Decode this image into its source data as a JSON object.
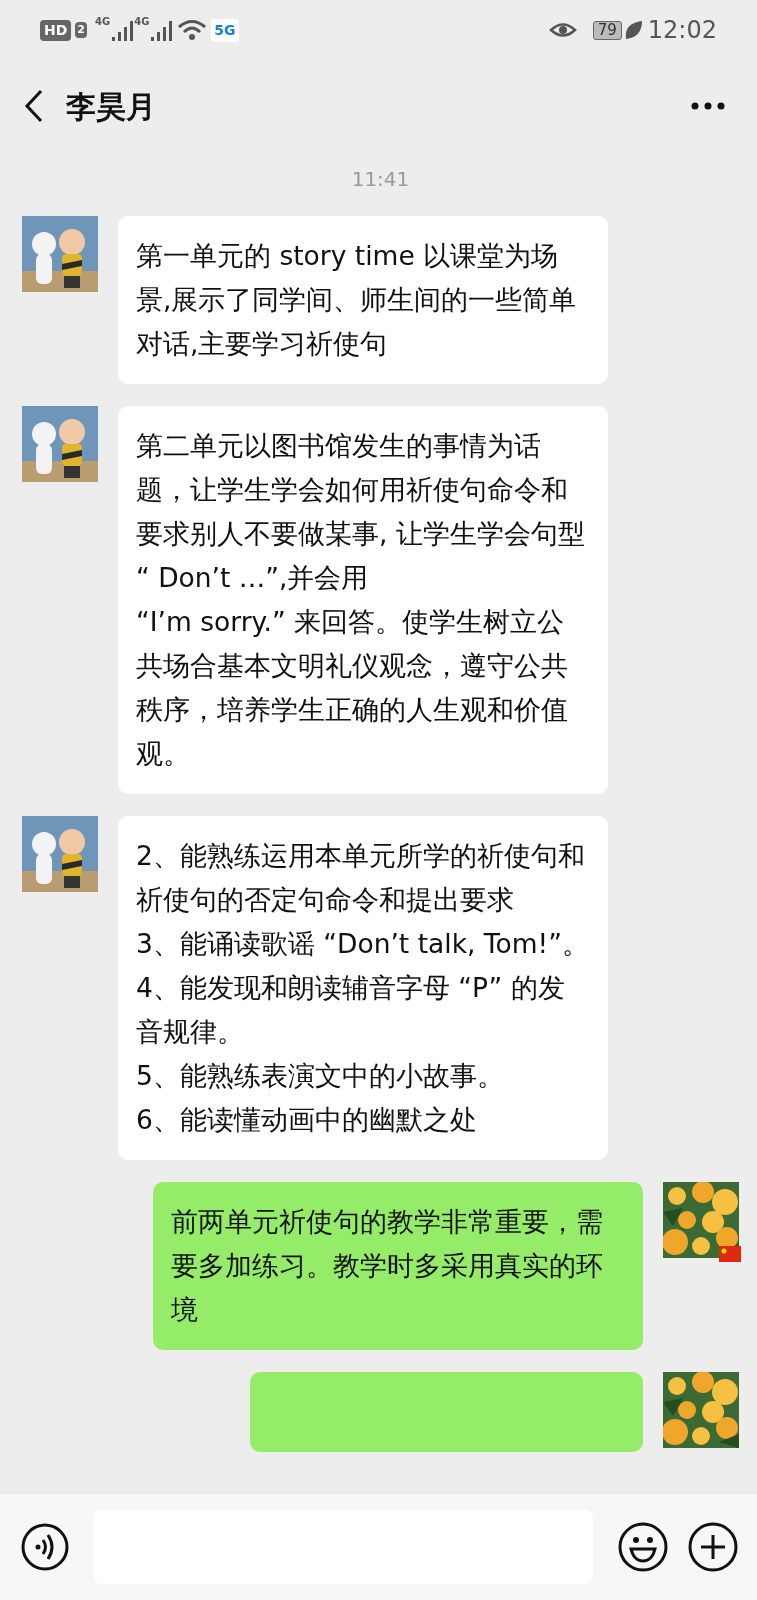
{
  "status_bar": {
    "hd": "HD",
    "sim": "2",
    "network_1": "4G",
    "network_2": "4G",
    "badge_5g": "5G",
    "battery": "79",
    "time": "12:02"
  },
  "header": {
    "title": "李昊月"
  },
  "messages": [
    {
      "kind": "time",
      "text": "11:41"
    },
    {
      "kind": "message",
      "outgoing": false,
      "text": "第一单元的 story time 以课堂为场景,展示了同学间、师生间的一些简单对话,主要学习祈使句"
    },
    {
      "kind": "message",
      "outgoing": false,
      "text": "第二单元以图书馆发生的事情为话题，让学生学会如何用祈使句命令和要求别人不要做某事, 让学生学会句型 “ Don’t …”,并会用\n“I’m sorry.” 来回答。使学生树立公共场合基本文明礼仪观念，遵守公共秩序，培养学生正确的人生观和价值观。"
    },
    {
      "kind": "message",
      "outgoing": false,
      "text": "2、能熟练运用本单元所学的祈使句和祈使句的否定句命令和提出要求\n3、能诵读歌谣 “Don’t talk, Tom!”。\n4、能发现和朗读辅音字母 “P” 的发音规律。\n5、能熟练表演文中的小故事。\n6、能读懂动画中的幽默之处"
    },
    {
      "kind": "message",
      "outgoing": true,
      "text": "前两单元祈使句的教学非常重要，需要多加练习。教学时多采用真实的环境"
    },
    {
      "kind": "message",
      "outgoing": true,
      "cut": true
    }
  ]
}
